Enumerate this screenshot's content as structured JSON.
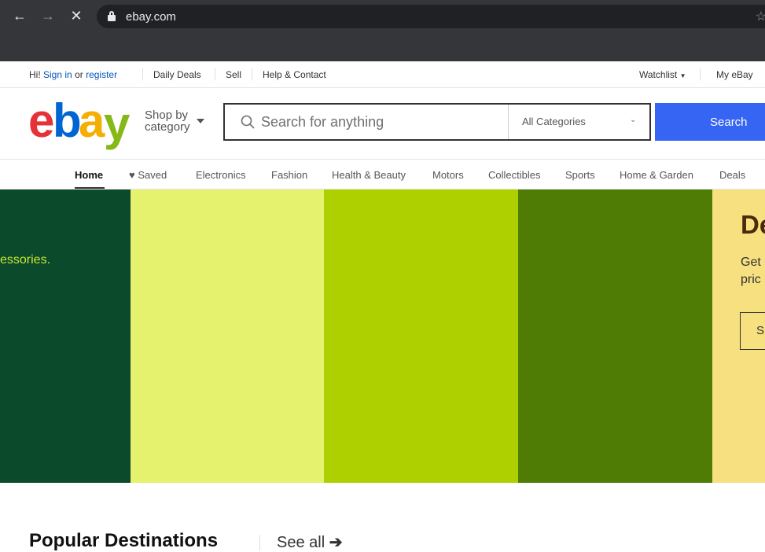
{
  "browser": {
    "url": "ebay.com",
    "back_icon": "arrow-left",
    "forward_icon": "arrow-right",
    "stop_icon": "close"
  },
  "top_bar": {
    "greeting": "Hi!",
    "sign_in": "Sign in",
    "or": "or",
    "register": "register",
    "daily_deals": "Daily Deals",
    "sell": "Sell",
    "help": "Help & Contact",
    "watchlist": "Watchlist",
    "my_ebay": "My eBay"
  },
  "header": {
    "shop_by_line1": "Shop by",
    "shop_by_line2": "category",
    "search_placeholder": "Search for anything",
    "category_select": "All Categories",
    "search_button": "Search"
  },
  "nav": {
    "items": [
      "Home",
      "Saved",
      "Electronics",
      "Fashion",
      "Health & Beauty",
      "Motors",
      "Collectibles",
      "Sports",
      "Home & Garden",
      "Deals"
    ]
  },
  "hero": {
    "left_text": "essories.",
    "right_title": "De",
    "right_sub_line1": "Get",
    "right_sub_line2": "pric",
    "right_button": "S",
    "colors": [
      "#0b4a2a",
      "#e4f26e",
      "#aed000",
      "#4e7c05",
      "#f6e07f"
    ]
  },
  "section": {
    "title": "Popular Destinations",
    "see_all": "See all"
  },
  "colors": {
    "ebay_e": "#e53238",
    "ebay_b": "#0064d2",
    "ebay_a": "#f5af02",
    "ebay_y": "#86b817",
    "search_blue": "#3665f3",
    "link_blue": "#0654ba"
  }
}
